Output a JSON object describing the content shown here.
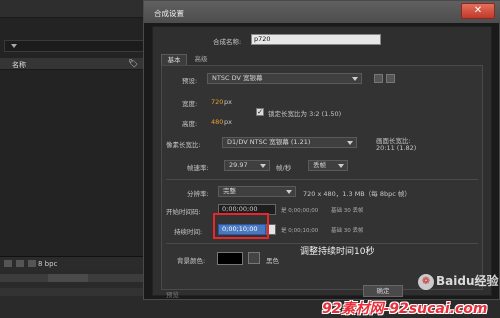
{
  "background_app": {
    "column_header": {
      "name_label": "名称",
      "tag_icon": "tag-icon",
      "hash_label": "#"
    },
    "status_bar": {
      "bpc_label": "8 bpc"
    }
  },
  "dialog": {
    "title": "合成设置",
    "close_label": "✕",
    "comp_name_label": "合成名称:",
    "comp_name_value": "p720",
    "tabs": [
      {
        "label": "基本",
        "active": true
      },
      {
        "label": "高级",
        "active": false
      }
    ],
    "preset_label": "预设:",
    "preset_value": "NTSC DV 宽银幕",
    "width_label": "宽度:",
    "width_value": "720",
    "width_unit": "px",
    "lock_aspect_label": "锁定长宽比为 3:2 (1.50)",
    "lock_aspect_checked": true,
    "height_label": "高度:",
    "height_value": "480",
    "height_unit": "px",
    "pixel_aspect_label": "像素长宽比:",
    "pixel_aspect_value": "D1/DV NTSC 宽银幕 (1.21)",
    "frame_aspect_label": "画面长宽比:",
    "frame_aspect_value": "20:11 (1.82)",
    "frame_rate_label": "帧速率:",
    "frame_rate_value": "29.97",
    "frame_rate_unit": "帧/秒",
    "frame_rate_mode": "丢帧",
    "resolution_label": "分辨率:",
    "resolution_value": "完整",
    "resolution_info": "720 x 480，1.3 MB（每 8bpc 帧）",
    "start_timecode_label": "开始时间码:",
    "start_timecode_value": "0;00;00;00",
    "start_timecode_info": "是 0;00;00;00",
    "start_timecode_base": "基础 30 丢帧",
    "duration_label": "持续时间:",
    "duration_value": "0;00;10;00",
    "duration_info": "是 0;00;10;00",
    "duration_base": "基础 30 丢帧",
    "bg_color_label": "背景颜色:",
    "bg_color_value": "#000000",
    "bg_color_name": "黑色",
    "preview_label": "预览",
    "ok_label": "确定"
  },
  "annotation": {
    "text": "调整持续时间10秒",
    "highlight_color": "#e8262e"
  },
  "watermarks": {
    "baidu_text": "Baidu经验",
    "site_text": "92素材网-92sucai.com"
  }
}
